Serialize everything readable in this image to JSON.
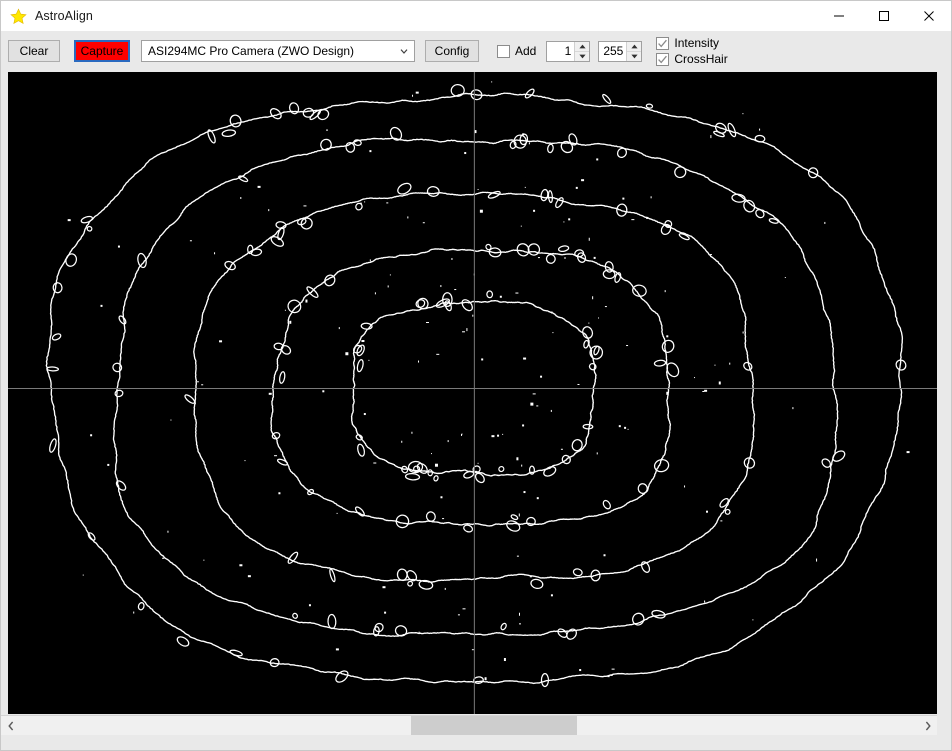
{
  "window": {
    "title": "AstroAlign",
    "app_icon": "star-icon",
    "controls": {
      "minimize": "minimize-icon",
      "maximize": "maximize-icon",
      "close": "close-icon"
    }
  },
  "toolbar": {
    "clear_label": "Clear",
    "capture_label": "Capture",
    "capture_bg_color": "#ff0000",
    "capture_focus_color": "#2a6ac0",
    "camera_select": {
      "value": "ASI294MC Pro Camera (ZWO Design)",
      "icon": "chevron-down-icon"
    },
    "config_label": "Config",
    "add_checkbox": {
      "label": "Add",
      "checked": false
    },
    "min_spinner": {
      "value": "1"
    },
    "max_spinner": {
      "value": "255"
    },
    "intensity_checkbox": {
      "label": "Intensity",
      "checked": true
    },
    "crosshair_checkbox": {
      "label": "CrossHair",
      "checked": true
    }
  },
  "canvas": {
    "background_color": "#000000",
    "contour_color": "#ffffff",
    "crosshair_color": "#7a7a7a",
    "crosshair_x_ratio": 0.502,
    "crosshair_y_ratio": 0.493,
    "description": "Defocused star intensity contour rings"
  },
  "scrollbar": {
    "left_arrow": "chevron-left-icon",
    "right_arrow": "chevron-right-icon",
    "thumb_start_ratio": 0.435,
    "thumb_width_ratio": 0.185
  },
  "chart_data": {
    "type": "line",
    "title": "Defocused star intensity contour rings",
    "xlabel": "",
    "ylabel": "",
    "center": [
      0.502,
      0.493
    ],
    "ring_count": 5,
    "rings": [
      {
        "name": "contour-1-outer",
        "rx_ratio": 0.455,
        "ry_ratio": 0.455,
        "noise": 0.012
      },
      {
        "name": "contour-2",
        "rx_ratio": 0.388,
        "ry_ratio": 0.385,
        "noise": 0.013
      },
      {
        "name": "contour-3",
        "rx_ratio": 0.3,
        "ry_ratio": 0.3,
        "noise": 0.014
      },
      {
        "name": "contour-4",
        "rx_ratio": 0.212,
        "ry_ratio": 0.213,
        "noise": 0.016
      },
      {
        "name": "contour-5-inner",
        "rx_ratio": 0.13,
        "ry_ratio": 0.133,
        "noise": 0.02
      }
    ],
    "speckle_count": 170,
    "grid": false,
    "legend": "none"
  }
}
